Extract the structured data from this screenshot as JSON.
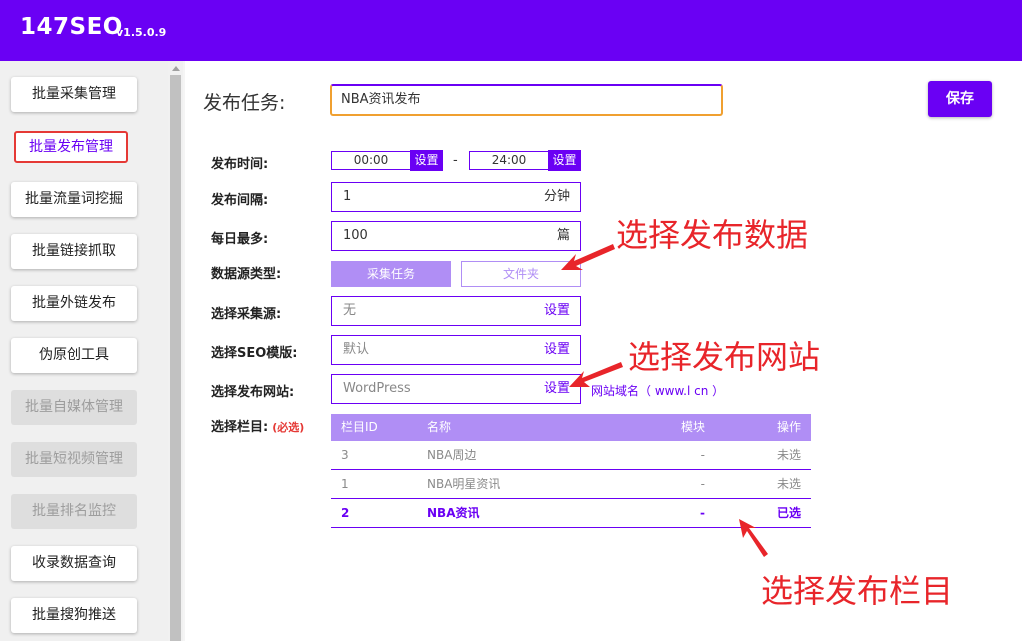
{
  "header": {
    "brand": "147SEO",
    "version": "v1.5.0.9"
  },
  "sidebar": {
    "items": [
      {
        "label": "批量采集管理"
      },
      {
        "label": "批量发布管理"
      },
      {
        "label": "批量流量词挖掘"
      },
      {
        "label": "批量链接抓取"
      },
      {
        "label": "批量外链发布"
      },
      {
        "label": "伪原创工具"
      },
      {
        "label": "批量自媒体管理"
      },
      {
        "label": "批量短视频管理"
      },
      {
        "label": "批量排名监控"
      },
      {
        "label": "收录数据查询"
      },
      {
        "label": "批量搜狗推送"
      }
    ]
  },
  "form": {
    "task_label": "发布任务:",
    "task_value": "NBA资讯发布",
    "save_label": "保存",
    "time_label": "发布时间:",
    "time_start": "00:00",
    "time_end": "24:00",
    "time_set": "设置",
    "time_dash": "-",
    "interval_label": "发布间隔:",
    "interval_value": "1",
    "interval_unit": "分钟",
    "daily_label": "每日最多:",
    "daily_value": "100",
    "daily_unit": "篇",
    "source_type_label": "数据源类型:",
    "source_task": "采集任务",
    "source_folder": "文件夹",
    "collect_label": "选择采集源:",
    "collect_value": "无",
    "set": "设置",
    "seo_label": "选择SEO模版:",
    "seo_value": "默认",
    "site_label": "选择发布网站:",
    "site_value": "WordPress",
    "site_domain": "网站域名（ www.l        cn ）",
    "column_label": "选择栏目:",
    "required": "(必选)"
  },
  "table": {
    "headers": [
      "栏目ID",
      "名称",
      "模块",
      "操作"
    ],
    "rows": [
      {
        "id": "3",
        "name": "NBA周边",
        "module": "-",
        "action": "未选"
      },
      {
        "id": "1",
        "name": "NBA明星资讯",
        "module": "-",
        "action": "未选"
      },
      {
        "id": "2",
        "name": "NBA资讯",
        "module": "-",
        "action": "已选"
      }
    ]
  },
  "annotations": {
    "data": "选择发布数据",
    "site": "选择发布网站",
    "column": "选择发布栏目",
    "color": "#e8252a"
  },
  "colors": {
    "accent": "#6a00f4",
    "accent_light": "#b08ef5",
    "highlight": "#e53935"
  }
}
